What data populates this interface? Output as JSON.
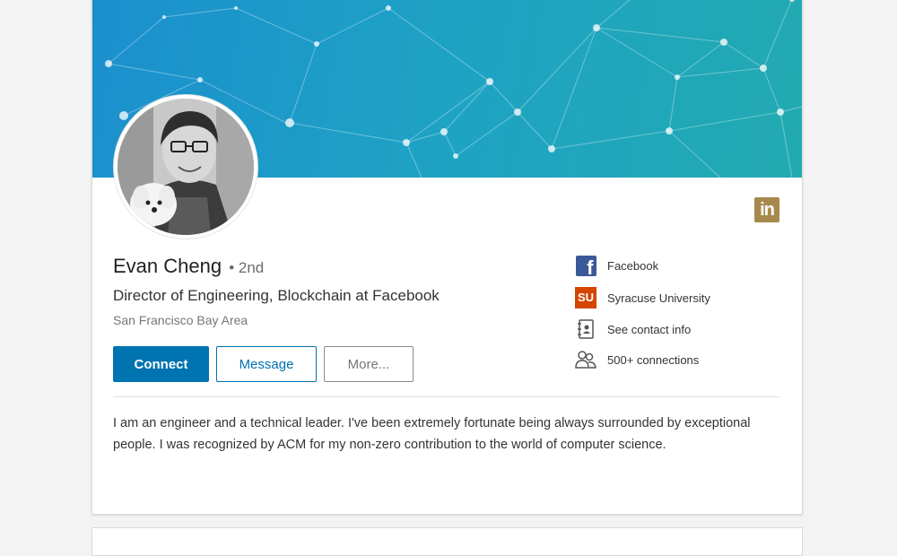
{
  "profile": {
    "name": "Evan Cheng",
    "degree": "• 2nd",
    "headline": "Director of Engineering, Blockchain at Facebook",
    "location": "San Francisco Bay Area",
    "summary": "I am an engineer and a technical leader. I've been extremely fortunate being always surrounded by exceptional people. I was recognized by ACM for my non-zero contribution to the world of computer science."
  },
  "actions": {
    "connect_label": "Connect",
    "message_label": "Message",
    "more_label": "More..."
  },
  "badge": {
    "text": "in",
    "icon": "linkedin-icon"
  },
  "sidebar": {
    "items": [
      {
        "label": "Facebook",
        "icon": "facebook-icon",
        "icon_text": "f"
      },
      {
        "label": "Syracuse University",
        "icon": "syracuse-university-icon",
        "icon_text": "SU"
      },
      {
        "label": "See contact info",
        "icon": "contact-book-icon"
      },
      {
        "label": "500+ connections",
        "icon": "people-icon"
      }
    ]
  },
  "colors": {
    "accent": "#0073b1",
    "facebook": "#3b5998",
    "syracuse": "#d44500",
    "linkedin_badge": "#a8894d"
  }
}
